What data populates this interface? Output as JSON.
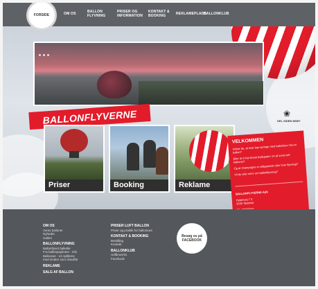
{
  "nav": {
    "home": "FORSIDE",
    "items": [
      "OM OS",
      "BALLON FLYVNING",
      "PRISER OG INFORMATION",
      "KONTAKT & BOOKING",
      "REKLAMEPLADS",
      "BALLONKLUB"
    ]
  },
  "slider": {
    "dots": 3
  },
  "brand": {
    "title": "BALLONFLYVERNE"
  },
  "logo_badge": {
    "text": "DEL SIDEN NEMT"
  },
  "cards": [
    {
      "label": "Priser"
    },
    {
      "label": "Booking"
    },
    {
      "label": "Reklame"
    }
  ],
  "welcome": {
    "title": "VELKOMMEN",
    "lines": [
      "Vidste du, at man kan springe med ballonkurv fra en ballon?",
      "Eller at vi har besat brylluppet i en af vores luft balloner?",
      "Og at champagne er obligatorisk efter hver flyvning?",
      "Vil du vide mere om ballonflyvning?"
    ],
    "company": "BALLONFLYVERNE ApS",
    "address1": "Hybenvej 7 3",
    "address2": "2630 Taastrup",
    "phone": "Tlf. 29200043",
    "email": "info@ballonflyverne.dk"
  },
  "footer": {
    "col1": [
      {
        "h": "OM OS",
        "t": [
          "Vores balloner",
          "Nyheder",
          "Galleri"
        ]
      },
      {
        "h": "BALLONFLYVNING",
        "t": [
          "Ballonflyvet balkelle",
          "Fra ballonpspiloten - info",
          "Ballooner - en spilleres",
          "med vinden som chauffør"
        ]
      },
      {
        "h": "REKLAME",
        "t": []
      },
      {
        "h": "SALG AF BALLON",
        "t": []
      }
    ],
    "col2": [
      {
        "h": "PRISER LUFT BALLON",
        "t": [
          "Priser og praktik for ballonture"
        ]
      },
      {
        "h": "KONTAKT & BOOKING",
        "t": [
          "Bestilling",
          "Kontakt"
        ]
      },
      {
        "h": "BALLONKLUB",
        "t": [
          "Udlånsvirks",
          "Facebook"
        ]
      }
    ],
    "facebook": "Besøg os på FACEBOOK"
  }
}
